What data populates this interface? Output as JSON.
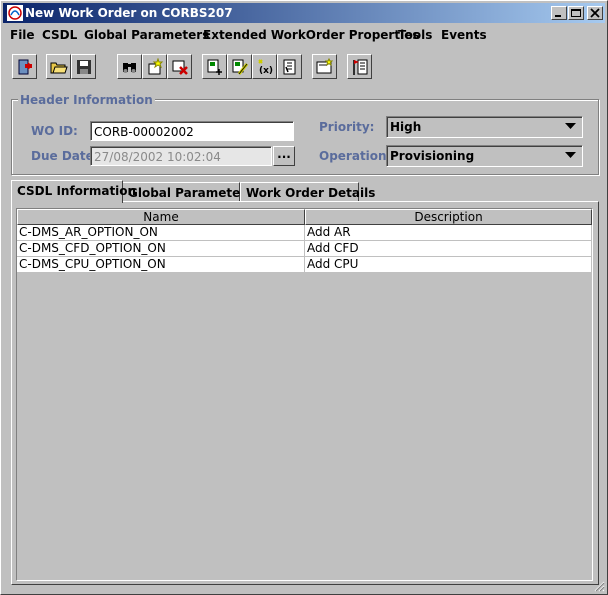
{
  "window": {
    "title": "New Work Order on  CORBS207"
  },
  "menu": [
    "File",
    "CSDL",
    "Global Parameters",
    "Extended WorkOrder Properties",
    "Tools",
    "Events"
  ],
  "header": {
    "group_title": "Header Information",
    "wo_id_label": "WO ID:",
    "wo_id_value": "CORB-00002002",
    "due_date_label": "Due Date:",
    "due_date_value": "27/08/2002 10:02:04",
    "browse_label": "...",
    "priority_label": "Priority:",
    "priority_value": "High",
    "operation_label": "Operation:",
    "operation_value": "Provisioning"
  },
  "tabs": [
    "CSDL Information",
    "Global Parameters",
    "Work Order Details"
  ],
  "table": {
    "columns": [
      "Name",
      "Description"
    ],
    "rows": [
      [
        "C-DMS_AR_OPTION_ON",
        "Add AR"
      ],
      [
        "C-DMS_CFD_OPTION_ON",
        "Add CFD"
      ],
      [
        "C-DMS_CPU_OPTION_ON",
        "Add CPU"
      ]
    ]
  },
  "icons": [
    "exit-icon",
    "open-folder-icon",
    "save-icon",
    "find-icon",
    "new-item-icon",
    "delete-item-icon",
    "add-csdl-icon",
    "edit-csdl-icon",
    "variable-icon",
    "script-icon",
    "properties-icon",
    "flag-icon"
  ]
}
